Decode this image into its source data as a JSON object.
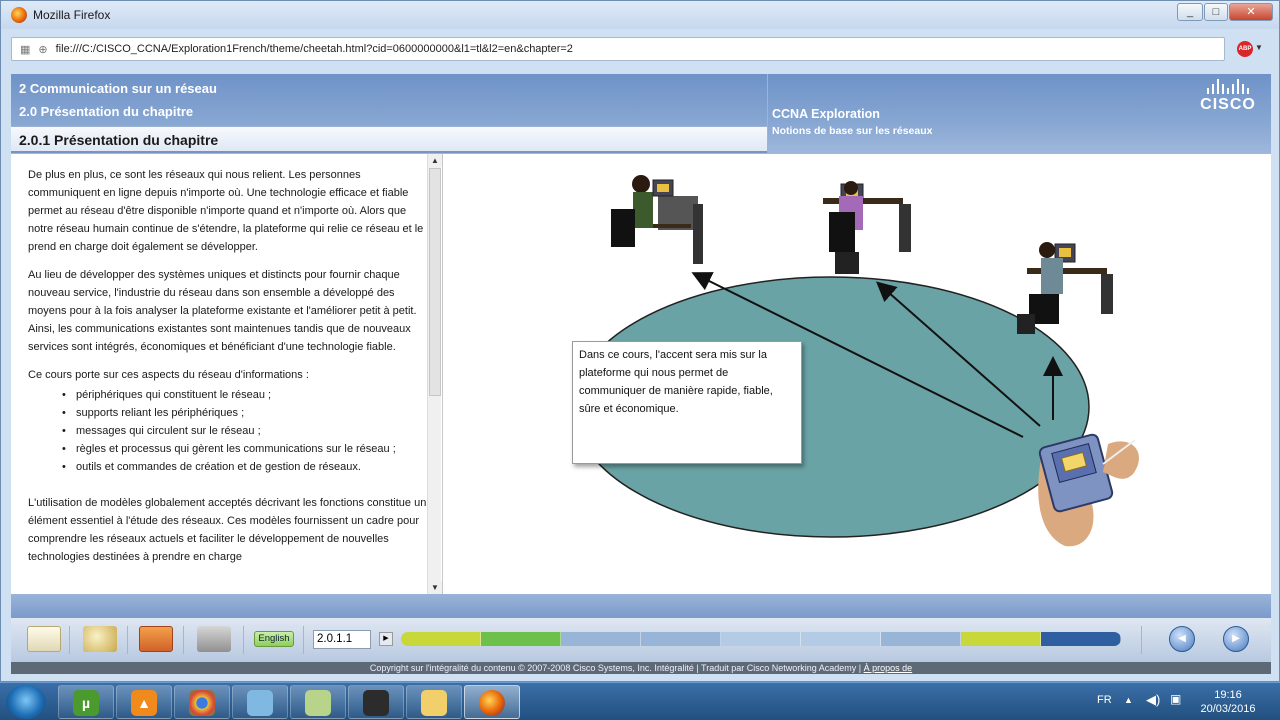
{
  "browser": {
    "title": "Mozilla Firefox",
    "url": "file:///C:/CISCO_CCNA/Exploration1French/theme/cheetah.html?cid=0600000000&l1=tl&l2=en&chapter=2",
    "addon": "ABP"
  },
  "course": {
    "chapter": "2 Communication sur un réseau",
    "section": "2.0 Présentation du chapitre",
    "subsection": "2.0.1 Présentation du chapitre",
    "program": "CCNA Exploration",
    "program_sub": "Notions de base sur les réseaux",
    "brand": "CISCO"
  },
  "content": {
    "p1": "De plus en plus, ce sont les réseaux qui nous relient. Les personnes communiquent en ligne depuis n'importe où. Une technologie efficace et fiable permet au réseau d'être disponible n'importe quand et n'importe où. Alors que notre réseau humain continue de s'étendre, la plateforme qui relie ce réseau et le prend en charge doit également se développer.",
    "p2": "Au lieu de développer des systèmes uniques et distincts pour fournir chaque nouveau service, l'industrie du réseau dans son ensemble a développé des moyens pour à la fois analyser la plateforme existante et l'améliorer petit à petit. Ainsi, les communications existantes sont maintenues tandis que de nouveaux services sont intégrés, économiques et bénéficiant d'une technologie fiable.",
    "p3": "Ce cours porte sur ces aspects du réseau d'informations :",
    "bullets": [
      "périphériques qui constituent le réseau ;",
      "supports reliant les périphériques ;",
      "messages qui circulent sur le réseau ;",
      "règles et processus qui gèrent les communications sur le réseau ;",
      "outils et commandes de création et de gestion de réseaux."
    ],
    "p4": "L'utilisation de modèles globalement acceptés décrivant les fonctions constitue un élément essentiel à l'étude des réseaux. Ces modèles fournissent un cadre pour comprendre les réseaux actuels et faciliter le développement de nouvelles technologies destinées à prendre en charge"
  },
  "figure": {
    "callout": "Dans ce cours, l'accent sera mis sur la plateforme qui nous permet de communiquer de manière rapide, fiable, sûre et économique."
  },
  "toolbar": {
    "language": "English",
    "page": "2.0.1.1",
    "progress_colors": [
      "#c8d83a",
      "#6dc14a",
      "#98b4d6",
      "#98b4d6",
      "#b4cbe6",
      "#b4cbe6",
      "#98b4d6",
      "#c8d83a",
      "#2f5fa0"
    ],
    "copyright": "Copyright sur l'intégralité du contenu © 2007-2008 Cisco Systems, Inc. Intégralité | Traduit par Cisco Networking Academy",
    "about": "À propos de"
  },
  "taskbar": {
    "apps": [
      "utorrent",
      "vlc",
      "chrome",
      "packet-tracer",
      "notes",
      "media-player",
      "explorer",
      "firefox"
    ],
    "lang": "FR",
    "time": "19:16",
    "date": "20/03/2016"
  }
}
